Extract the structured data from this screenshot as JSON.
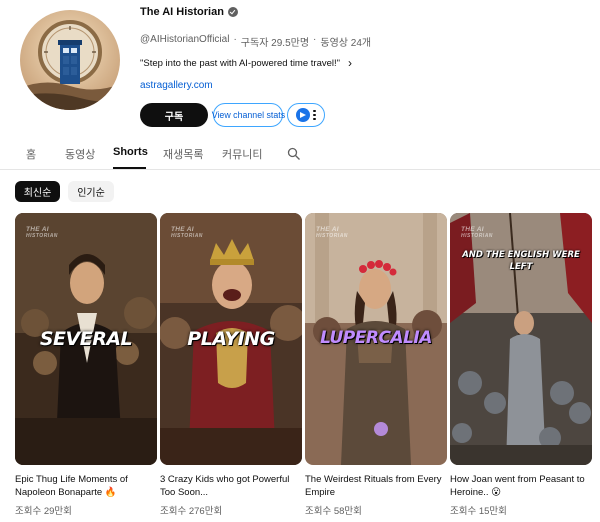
{
  "channel": {
    "name": "The AI Historian",
    "handle": "@AIHistorianOfficial",
    "subscribers": "구독자 29.5만명",
    "video_count": "동영상 24개",
    "separator": "·",
    "description": "\"Step into the past with AI-powered time travel!\"",
    "link": "astragallery.com",
    "subscribe_label": "구독",
    "stats_label": "View channel stats",
    "icons": {
      "verified": "verified-check-icon",
      "more": "chevron-right-icon",
      "extension": "extension-icon",
      "kebab": "more-vert-icon"
    }
  },
  "tabs": [
    {
      "label": "홈"
    },
    {
      "label": "동영상"
    },
    {
      "label": "Shorts",
      "active": true
    },
    {
      "label": "재생목록"
    },
    {
      "label": "커뮤니티"
    }
  ],
  "sort_chips": [
    {
      "label": "최신순",
      "active": true
    },
    {
      "label": "인기순"
    }
  ],
  "shorts": [
    {
      "title": "Epic Thug Life Moments of Napoleon Bonaparte 🔥",
      "views": "조회수 29만회",
      "caption": "SEVERAL",
      "watermark": "THE AI",
      "watermark_sub": "HISTORIAN"
    },
    {
      "title": "3 Crazy Kids who got Powerful Too Soon...",
      "views": "조회수 276만회",
      "caption": "PLAYING",
      "watermark": "THE AI",
      "watermark_sub": "HISTORIAN"
    },
    {
      "title": "The Weirdest Rituals from Every Empire",
      "views": "조회수 58만회",
      "caption": "LUPERCALIA",
      "watermark": "THE AI",
      "watermark_sub": "HISTORIAN"
    },
    {
      "title": "How Joan went from Peasant to Heroine.. 😮",
      "views": "조회수 15만회",
      "caption_top": "AND THE ENGLISH WERE LEFT",
      "watermark": "THE AI",
      "watermark_sub": "HISTORIAN"
    }
  ],
  "colors": {
    "accent_link": "#065fd4",
    "subscribe_bg": "#0f0f0f",
    "chip_active": "#0f0f0f",
    "chip_inactive": "#f2f2f2",
    "caption_lupercalia": "#c08cff"
  }
}
